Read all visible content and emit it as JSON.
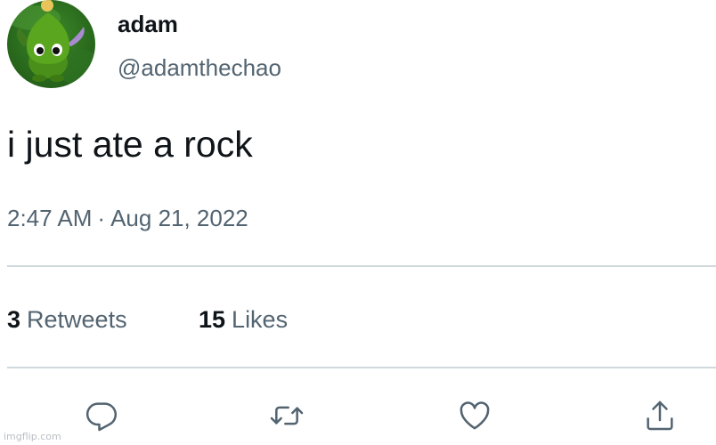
{
  "user": {
    "display_name": "adam",
    "handle": "@adamthechao",
    "avatar_icon": "chao-avatar-icon"
  },
  "tweet": {
    "text": "i just ate a rock",
    "time": "2:47 AM",
    "separator": "·",
    "date": "Aug 21, 2022"
  },
  "stats": {
    "retweets_count": "3",
    "retweets_label": "Retweets",
    "likes_count": "15",
    "likes_label": "Likes"
  },
  "actions": {
    "reply_icon": "reply-icon",
    "retweet_icon": "retweet-icon",
    "like_icon": "heart-icon",
    "share_icon": "share-icon"
  },
  "watermark": "imgflip.com",
  "colors": {
    "text_primary": "#0f1419",
    "text_secondary": "#536471",
    "divider": "#cfd9de",
    "icon": "#536471"
  }
}
